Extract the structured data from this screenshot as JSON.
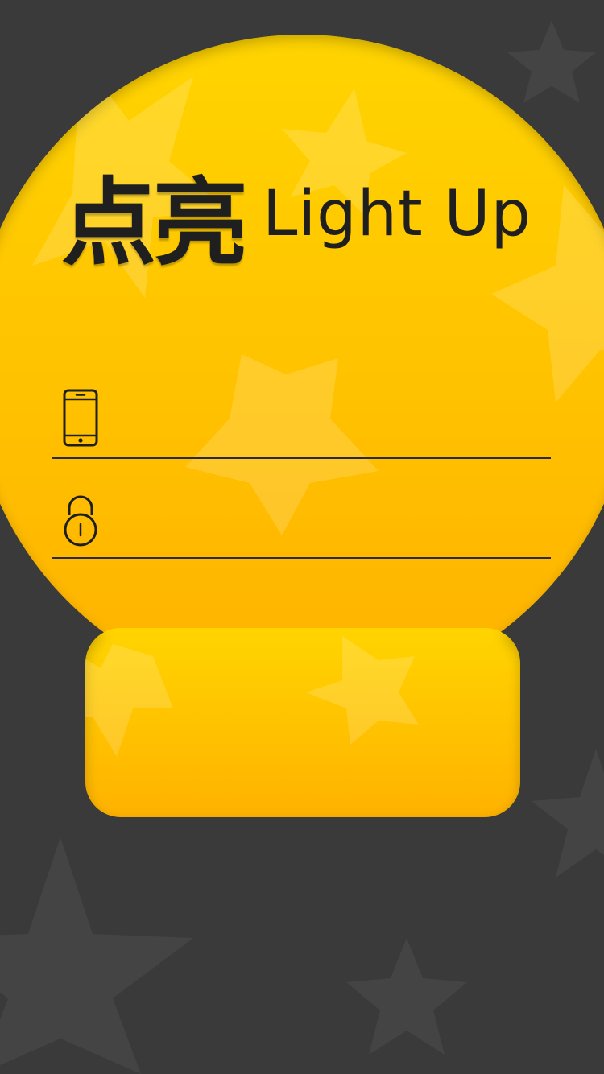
{
  "app": {
    "title_cn": "点亮",
    "title_en": "Light Up"
  },
  "form": {
    "phone": {
      "icon": "phone-icon",
      "value": "",
      "placeholder": ""
    },
    "password": {
      "icon": "lock-icon",
      "value": "",
      "placeholder": ""
    }
  },
  "colors": {
    "background": "#3a3a3a",
    "bulb_top": "#ffd200",
    "bulb_bottom": "#ffb300",
    "text": "#1f1f1f"
  }
}
